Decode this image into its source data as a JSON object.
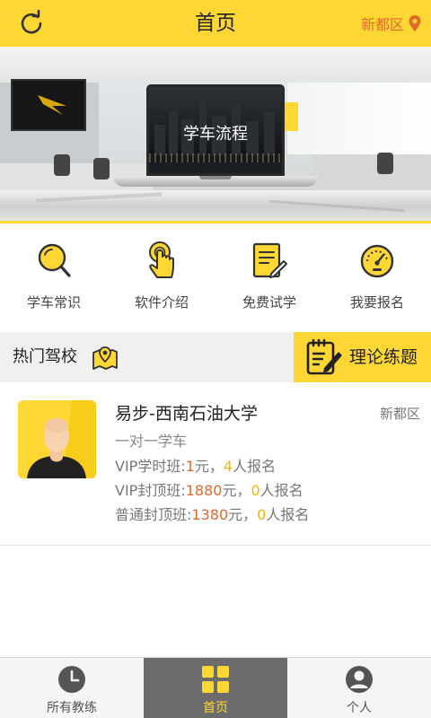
{
  "header": {
    "title": "首页",
    "location": "新都区",
    "refresh_icon": "refresh-icon",
    "location_icon": "location-pin-icon"
  },
  "banner": {
    "caption": "学车流程"
  },
  "menu": {
    "items": [
      {
        "label": "学车常识",
        "icon": "search-icon"
      },
      {
        "label": "软件介绍",
        "icon": "pointer-hand-icon"
      },
      {
        "label": "免费试学",
        "icon": "document-edit-icon"
      },
      {
        "label": "我要报名",
        "icon": "dashboard-gauge-icon"
      }
    ]
  },
  "section": {
    "title": "热门驾校",
    "title_icon": "map-icon",
    "practice_label": "理论练题",
    "practice_icon": "notepad-pen-icon"
  },
  "school": {
    "name": "易步-西南石油大学",
    "district": "新都区",
    "description": "一对一学车",
    "lines": [
      {
        "label": "VIP学时班:",
        "price": "1",
        "price_unit": "元，",
        "count": "4",
        "count_unit": "人报名"
      },
      {
        "label": "VIP封顶班:",
        "price": "1880",
        "price_unit": "元，",
        "count": "0",
        "count_unit": "人报名"
      },
      {
        "label": "普通封顶班:",
        "price": "1380",
        "price_unit": "元，",
        "count": "0",
        "count_unit": "人报名"
      }
    ]
  },
  "tabbar": {
    "tabs": [
      {
        "label": "所有教练",
        "icon": "clock-icon",
        "active": false
      },
      {
        "label": "首页",
        "icon": "grid-icon",
        "active": true
      },
      {
        "label": "个人",
        "icon": "user-icon",
        "active": false
      }
    ]
  },
  "colors": {
    "accent": "#ffd735",
    "highlight": "#e06a2a",
    "active_tab_bg": "#6c6c6c"
  }
}
